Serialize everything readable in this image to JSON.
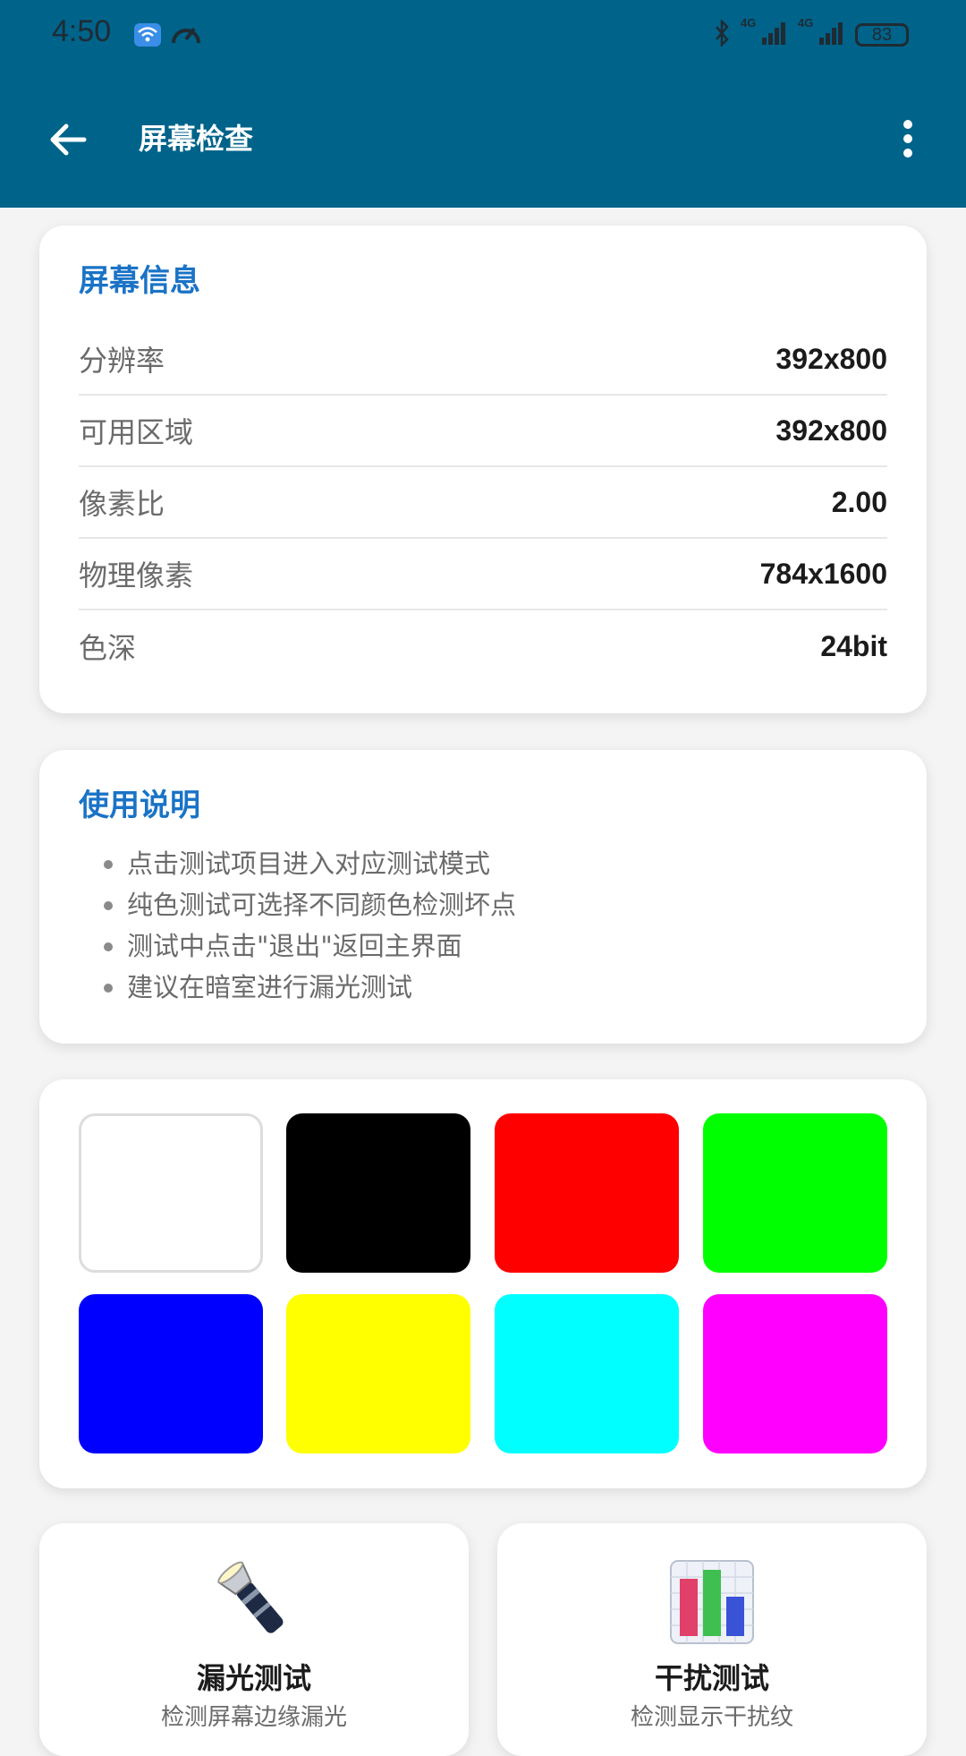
{
  "status_bar": {
    "time": "4:50",
    "battery": "83",
    "network_1": "4G",
    "network_2": "4G"
  },
  "app_bar": {
    "title": "屏幕检查"
  },
  "screen_info": {
    "title": "屏幕信息",
    "rows": [
      {
        "label": "分辨率",
        "value": "392x800"
      },
      {
        "label": "可用区域",
        "value": "392x800"
      },
      {
        "label": "像素比",
        "value": "2.00"
      },
      {
        "label": "物理像素",
        "value": "784x1600"
      },
      {
        "label": "色深",
        "value": "24bit"
      }
    ]
  },
  "instructions": {
    "title": "使用说明",
    "items": [
      "点击测试项目进入对应测试模式",
      "纯色测试可选择不同颜色检测坏点",
      "测试中点击\"退出\"返回主界面",
      "建议在暗室进行漏光测试"
    ]
  },
  "color_swatches": {
    "colors": [
      "#ffffff",
      "#000000",
      "#ff0000",
      "#00ff00",
      "#0000ff",
      "#ffff00",
      "#00ffff",
      "#ff00ff"
    ]
  },
  "tests": [
    {
      "title": "漏光测试",
      "subtitle": "检测屏幕边缘漏光",
      "icon": "flashlight-icon"
    },
    {
      "title": "干扰测试",
      "subtitle": "检测显示干扰纹",
      "icon": "bar-chart-icon"
    }
  ],
  "theme": {
    "primary": "#00638a",
    "accent": "#1a73c6"
  }
}
